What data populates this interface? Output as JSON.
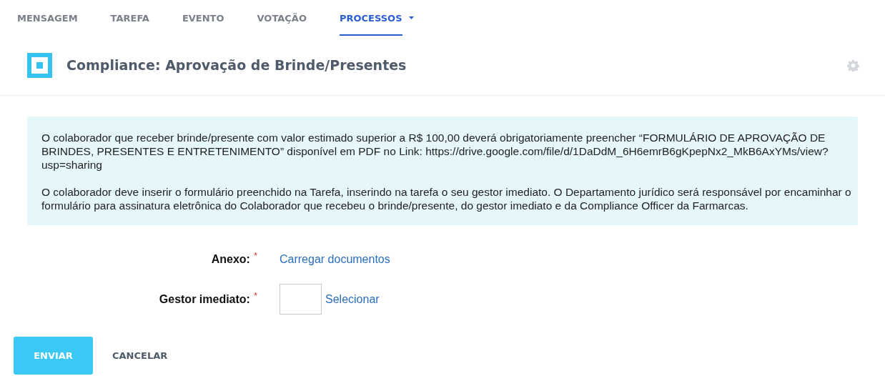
{
  "tabs": [
    {
      "label": "MENSAGEM",
      "selected": false,
      "dropdown": false
    },
    {
      "label": "TAREFA",
      "selected": false,
      "dropdown": false
    },
    {
      "label": "EVENTO",
      "selected": false,
      "dropdown": false
    },
    {
      "label": "VOTAÇÃO",
      "selected": false,
      "dropdown": false
    },
    {
      "label": "PROCESSOS",
      "selected": true,
      "dropdown": true
    }
  ],
  "header": {
    "title": "Compliance: Aprovação de Brinde/Presentes"
  },
  "info": {
    "paragraphs": [
      "O colaborador que receber brinde/presente com valor estimado superior a R$ 100,00 deverá obrigatoriamente preencher “FORMULÁRIO DE APROVAÇÃO DE BRINDES, PRESENTES E ENTRETENIMENTO” disponível em PDF no Link: https://drive.google.com/file/d/1DaDdM_6H6emrB6gKpepNx2_MkB6AxYMs/view?usp=sharing",
      "O colaborador deve inserir o formulário preenchido na Tarefa, inserindo na tarefa o seu gestor imediato. O Departamento jurídico será responsável por encaminhar o formulário para assinatura eletrônica do Colaborador que recebeu o brinde/presente, do gestor imediato e da Compliance Officer da Farmarcas."
    ]
  },
  "form": {
    "fields": [
      {
        "kind": "upload",
        "label": "Anexo:",
        "required": true,
        "required_mark": "*",
        "action": "Carregar documentos"
      },
      {
        "kind": "picker",
        "label": "Gestor imediato:",
        "required": true,
        "required_mark": "*",
        "action": "Selecionar"
      }
    ]
  },
  "buttons": {
    "submit": "ENVIAR",
    "cancel": "CANCELAR"
  }
}
